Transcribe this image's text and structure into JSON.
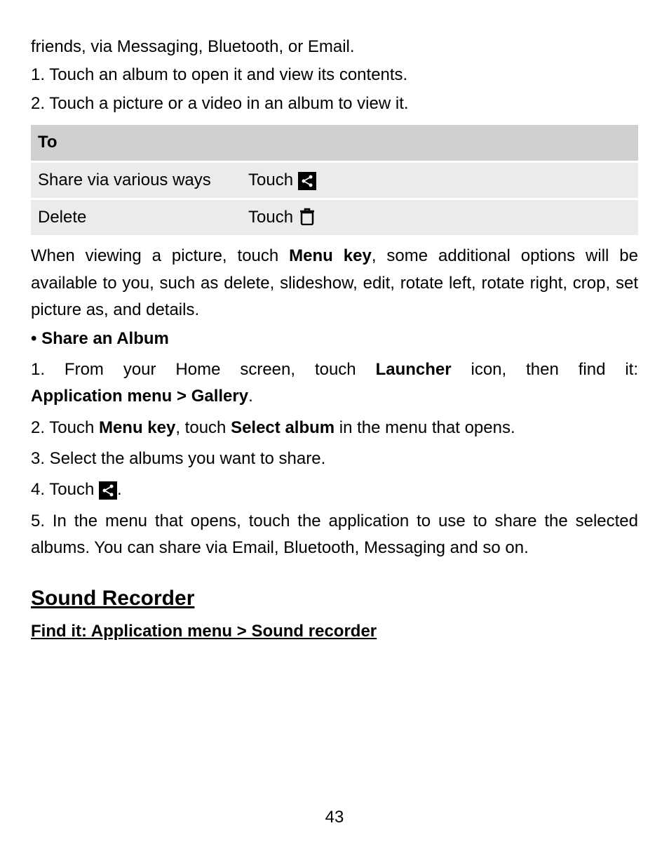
{
  "intro": {
    "line1": "friends, via Messaging, Bluetooth, or Email.",
    "line2": "1. Touch an album to open it and view its contents.",
    "line3": "2. Touch a picture or a video in an album to view it."
  },
  "table": {
    "header": "To",
    "row1_label": "Share via various ways",
    "row1_action": "Touch ",
    "row2_label": "Delete",
    "row2_action": "Touch "
  },
  "after_table": {
    "seg1": "When viewing a picture, touch ",
    "seg2": "Menu key",
    "seg3": ", some additional options will be available to you, such as delete, slideshow, edit, rotate left, rotate right, crop, set picture as, and details."
  },
  "share_album": {
    "bullet": "• Share an Album",
    "step1_a": "1. From your Home screen, touch ",
    "step1_b": "Launcher",
    "step1_c": " icon, then find it: ",
    "step1_d": "Application menu > Gallery",
    "step1_e": ".",
    "step2_a": "2. Touch ",
    "step2_b": "Menu key",
    "step2_c": ", touch ",
    "step2_d": "Select album",
    "step2_e": " in the menu that opens.",
    "step3": "3. Select the albums you want to share.",
    "step4_a": "4. Touch ",
    "step4_c": ".",
    "step5": "5. In the menu that opens, touch the application to use to share the selected albums. You can share via Email, Bluetooth, Messaging and so on."
  },
  "section": {
    "title": "Sound Recorder",
    "subhead": "Find it: Application menu > Sound recorder"
  },
  "page_number": "43"
}
